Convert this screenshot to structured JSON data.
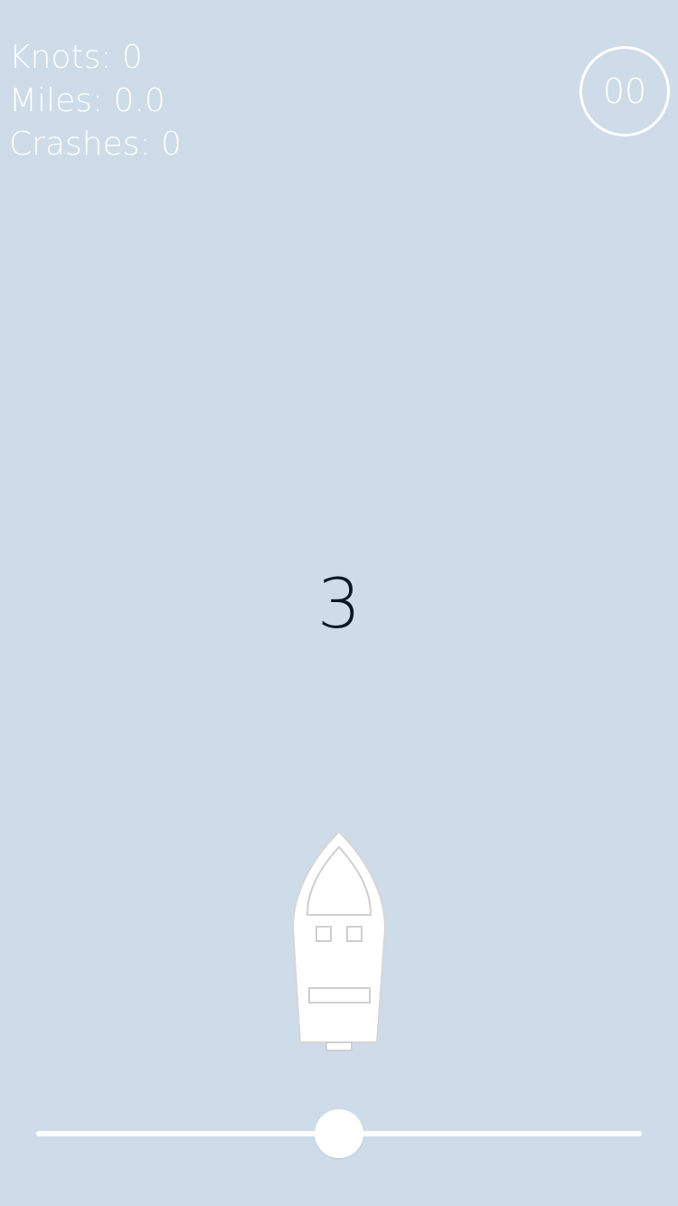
{
  "stats": {
    "knots": "Knots: 0",
    "miles": "Miles: 0.0",
    "crashes": "Crashes: 0"
  },
  "timer": "00",
  "countdown": "3",
  "throttle": {
    "value": 0.5
  },
  "colors": {
    "water": "#CDDCE8",
    "text_light": "#FFFFFF",
    "countdown_text": "#0B1622"
  },
  "icons": {
    "player": "boat-icon"
  }
}
